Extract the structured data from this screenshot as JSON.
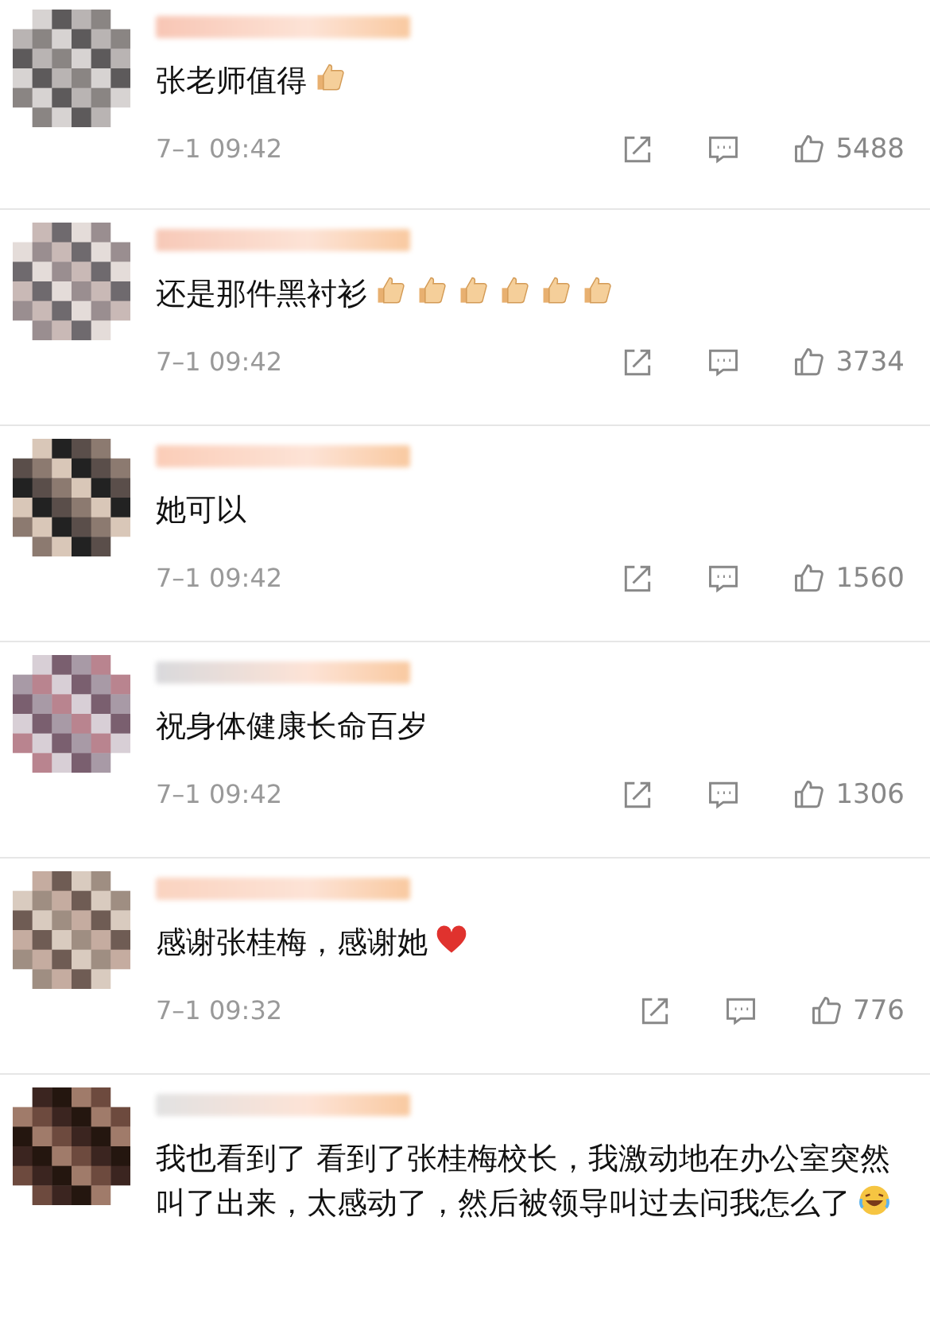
{
  "comments": [
    {
      "text": "张老师值得",
      "emojis": [
        {
          "kind": "thumbs"
        }
      ],
      "time": "7–1 09:42",
      "likes": "5488"
    },
    {
      "text": "还是那件黑衬衫",
      "emojis": [
        {
          "kind": "thumbs"
        },
        {
          "kind": "thumbs"
        },
        {
          "kind": "thumbs"
        },
        {
          "kind": "thumbs"
        },
        {
          "kind": "thumbs"
        },
        {
          "kind": "thumbs"
        }
      ],
      "time": "7–1 09:42",
      "likes": "3734"
    },
    {
      "text": "她可以",
      "time": "7–1 09:42",
      "likes": "1560"
    },
    {
      "text": "祝身体健康长命百岁",
      "time": "7–1 09:42",
      "likes": "1306"
    },
    {
      "text": "感谢张桂梅，感谢她",
      "emojis": [
        {
          "kind": "heart"
        }
      ],
      "time": "7–1 09:32",
      "likes": "776"
    },
    {
      "text": "我也看到了  看到了张桂梅校长，我激动地在办公室突然叫了出来，太感动了，然后被领导叫过去问我怎么了",
      "emojis": [
        {
          "kind": "laugh"
        }
      ]
    }
  ]
}
